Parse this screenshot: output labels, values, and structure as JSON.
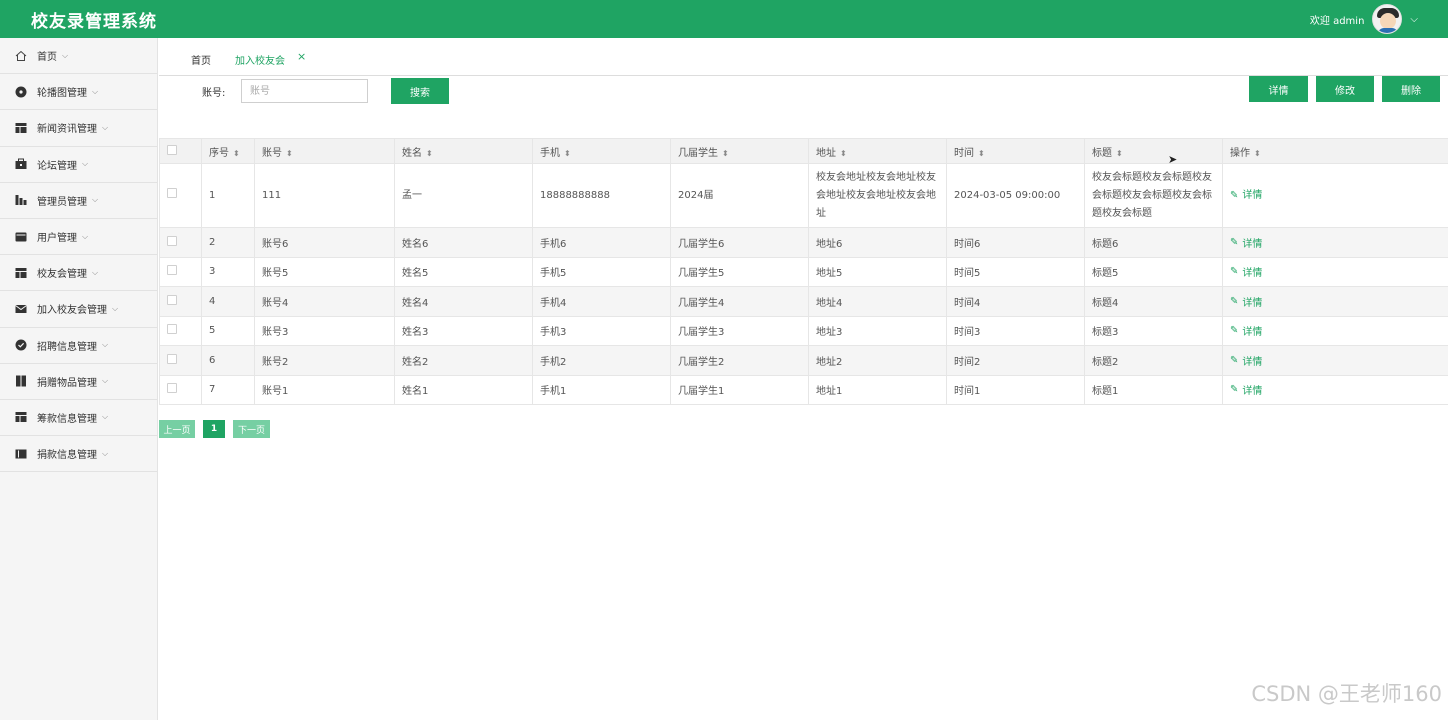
{
  "header": {
    "app_title": "校友录管理系统",
    "welcome_text": "欢迎 admin",
    "caret": "⌵"
  },
  "sidebar": {
    "items": [
      {
        "label": "首页",
        "icon": "home-icon"
      },
      {
        "label": "轮播图管理",
        "icon": "carousel-icon"
      },
      {
        "label": "新闻资讯管理",
        "icon": "news-icon"
      },
      {
        "label": "论坛管理",
        "icon": "forum-icon"
      },
      {
        "label": "管理员管理",
        "icon": "admin-icon"
      },
      {
        "label": "用户管理",
        "icon": "user-icon"
      },
      {
        "label": "校友会管理",
        "icon": "alumni-icon"
      },
      {
        "label": "加入校友会管理",
        "icon": "mail-icon"
      },
      {
        "label": "招聘信息管理",
        "icon": "recruit-icon"
      },
      {
        "label": "捐赠物品管理",
        "icon": "donation-goods-icon"
      },
      {
        "label": "筹款信息管理",
        "icon": "fundraising-icon"
      },
      {
        "label": "捐款信息管理",
        "icon": "donation-icon"
      }
    ]
  },
  "tabs": {
    "home": "首页",
    "active": "加入校友会",
    "close": "×"
  },
  "search": {
    "label": "账号:",
    "placeholder": "账号",
    "value": "",
    "button": "搜索"
  },
  "actions": {
    "detail": "详情",
    "edit": "修改",
    "delete": "删除"
  },
  "table": {
    "columns": [
      "序号",
      "账号",
      "姓名",
      "手机",
      "几届学生",
      "地址",
      "时间",
      "标题",
      "操作"
    ],
    "op_label": "详情",
    "rows": [
      {
        "no": "1",
        "account": "111",
        "name": "孟一",
        "phone": "18888888888",
        "grade": "2024届",
        "address": "校友会地址校友会地址校友会地址校友会地址校友会地址",
        "time": "2024-03-05 09:00:00",
        "title": "校友会标题校友会标题校友会标题校友会标题校友会标题校友会标题"
      },
      {
        "no": "2",
        "account": "账号6",
        "name": "姓名6",
        "phone": "手机6",
        "grade": "几届学生6",
        "address": "地址6",
        "time": "时间6",
        "title": "标题6"
      },
      {
        "no": "3",
        "account": "账号5",
        "name": "姓名5",
        "phone": "手机5",
        "grade": "几届学生5",
        "address": "地址5",
        "time": "时间5",
        "title": "标题5"
      },
      {
        "no": "4",
        "account": "账号4",
        "name": "姓名4",
        "phone": "手机4",
        "grade": "几届学生4",
        "address": "地址4",
        "time": "时间4",
        "title": "标题4"
      },
      {
        "no": "5",
        "account": "账号3",
        "name": "姓名3",
        "phone": "手机3",
        "grade": "几届学生3",
        "address": "地址3",
        "time": "时间3",
        "title": "标题3"
      },
      {
        "no": "6",
        "account": "账号2",
        "name": "姓名2",
        "phone": "手机2",
        "grade": "几届学生2",
        "address": "地址2",
        "time": "时间2",
        "title": "标题2"
      },
      {
        "no": "7",
        "account": "账号1",
        "name": "姓名1",
        "phone": "手机1",
        "grade": "几届学生1",
        "address": "地址1",
        "time": "时间1",
        "title": "标题1"
      }
    ]
  },
  "pager": {
    "prev": "上一页",
    "current": "1",
    "next": "下一页"
  },
  "watermark": "CSDN @王老师160",
  "colors": {
    "accent": "#1fa463",
    "pager_light": "#76cfa3"
  }
}
